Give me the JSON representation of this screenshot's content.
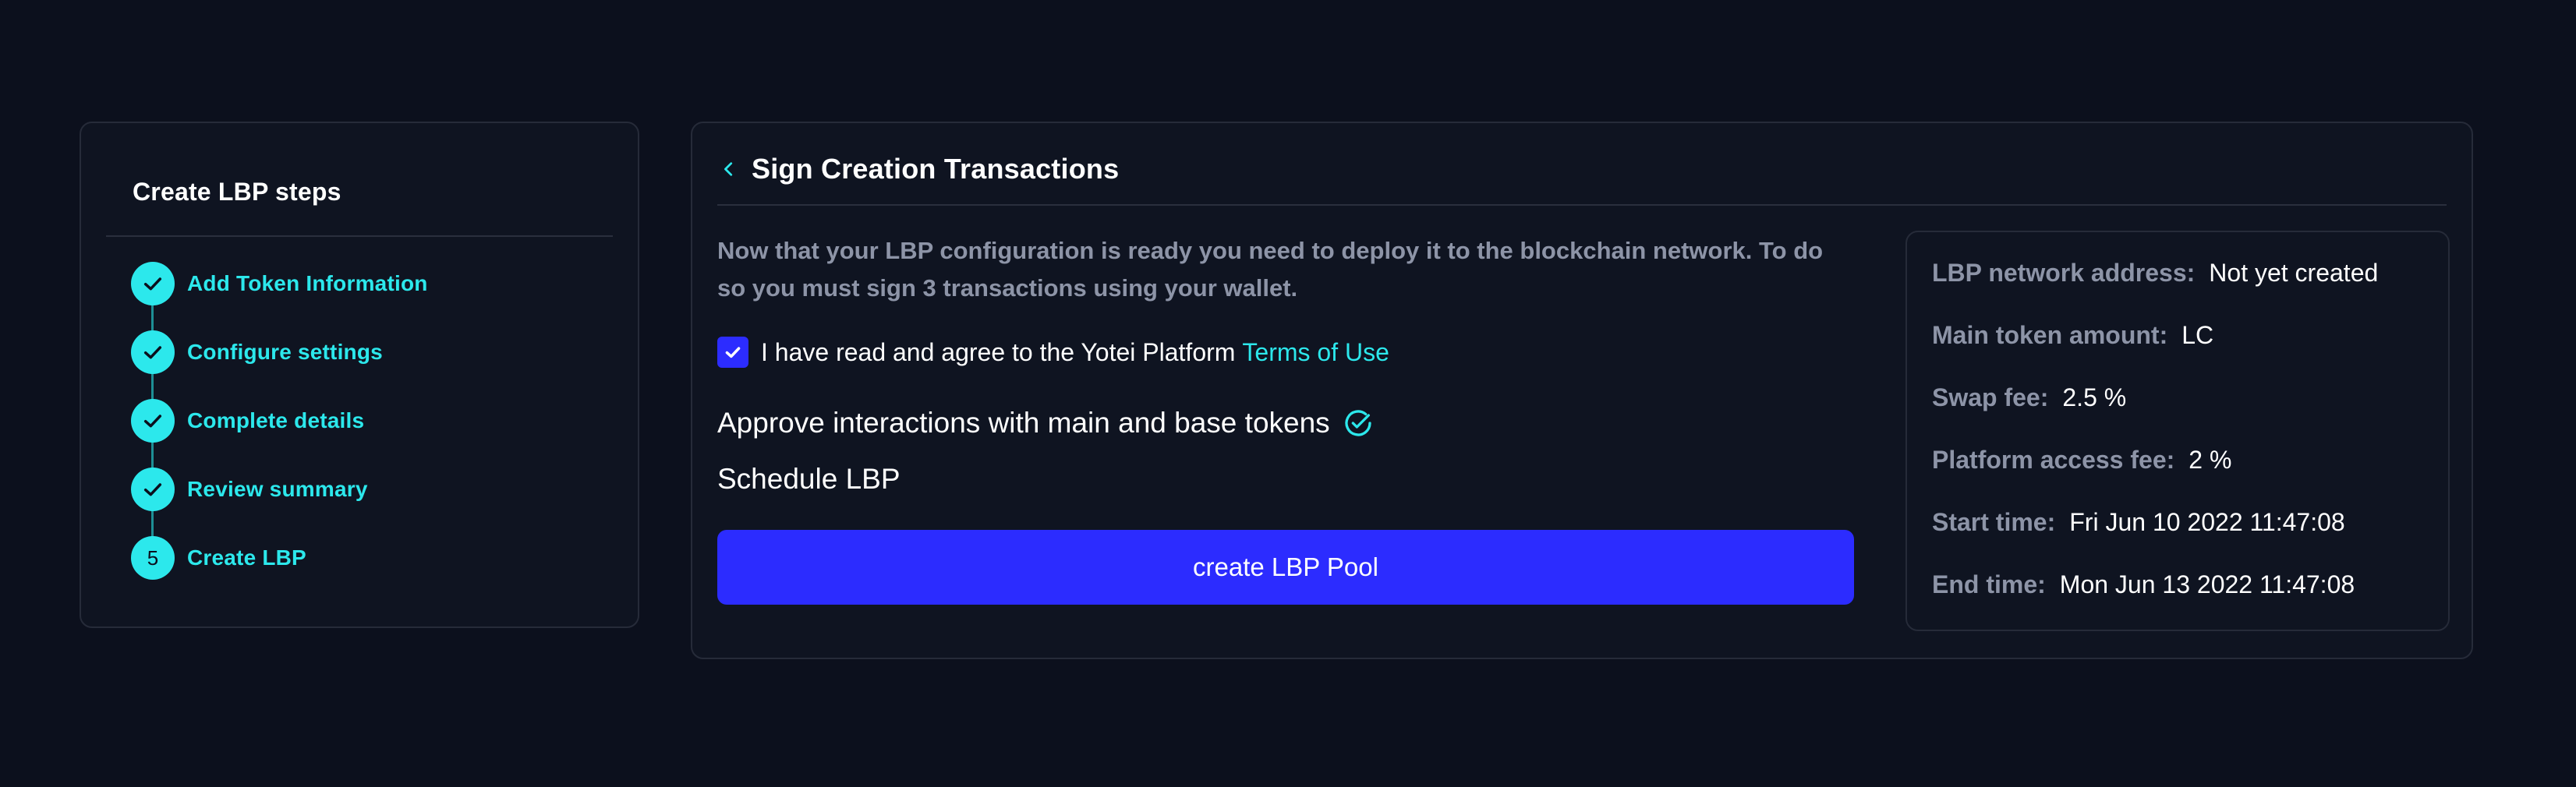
{
  "steps": {
    "title": "Create LBP steps",
    "items": [
      {
        "label": "Add Token Information",
        "status": "completed"
      },
      {
        "label": "Configure settings",
        "status": "completed"
      },
      {
        "label": "Complete details",
        "status": "completed"
      },
      {
        "label": "Review summary",
        "status": "completed"
      },
      {
        "label": "Create LBP",
        "status": "current",
        "number": "5"
      }
    ]
  },
  "main": {
    "title": "Sign Creation Transactions",
    "intro": "Now that your LBP configuration is ready you need to deploy it to the blockchain network. To do so you must sign 3 transactions using your wallet.",
    "agree_text": "I have read and agree to the Yotei Platform",
    "terms_link": "Terms of Use",
    "agree_checked": true,
    "approve_text": "Approve interactions with main and base tokens",
    "schedule_text": "Schedule LBP",
    "create_button": "create LBP Pool"
  },
  "summary": [
    {
      "label": "LBP network address:",
      "value": "Not yet created"
    },
    {
      "label": "Main token amount:",
      "value": "LC"
    },
    {
      "label": "Swap fee:",
      "value": "2.5 %"
    },
    {
      "label": "Platform access fee:",
      "value": "2 %"
    },
    {
      "label": "Start time:",
      "value": "Fri Jun 10 2022 11:47:08"
    },
    {
      "label": "End time:",
      "value": "Mon Jun 13 2022 11:47:08"
    }
  ],
  "colors": {
    "background": "#0c101d",
    "card": "#0f1421",
    "accent_cyan": "#2ce8ec",
    "button_blue": "#2c2cff",
    "muted_text": "#8d94a7"
  },
  "icons": {
    "back": "chevron-left-icon",
    "step_done": "check-icon",
    "checkbox": "check-icon",
    "approve_done": "check-circle-icon"
  }
}
